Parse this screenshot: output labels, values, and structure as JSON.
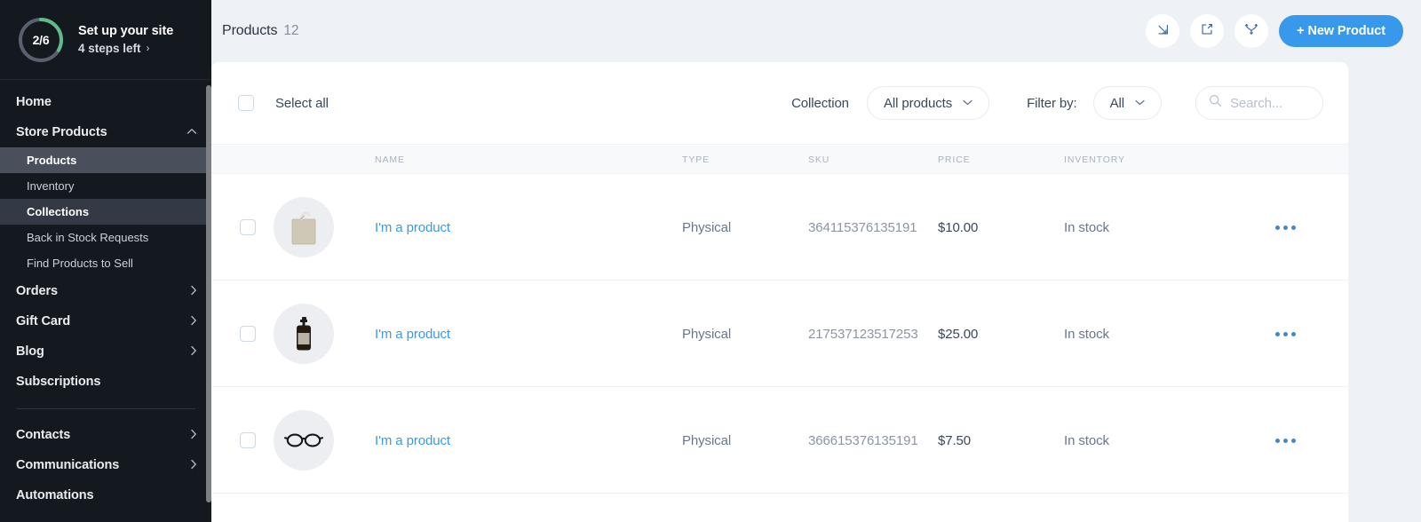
{
  "colors": {
    "accent": "#3899ec",
    "sidebar_bg": "#14181f",
    "progress_green": "#5bbd8a",
    "progress_track": "#5a6070",
    "page_bg": "#eef1f5"
  },
  "sidebar": {
    "setup": {
      "progress_text": "2/6",
      "progress_value": 2,
      "progress_total": 6,
      "title": "Set up your site",
      "subtitle": "4 steps left",
      "chevron": "›"
    },
    "items": [
      {
        "label": "Home",
        "type": "item",
        "caret": "",
        "state": ""
      },
      {
        "label": "Store Products",
        "type": "item",
        "caret": "⌃",
        "state": "expanded"
      },
      {
        "label": "Products",
        "type": "sub",
        "state": "active"
      },
      {
        "label": "Inventory",
        "type": "sub",
        "state": ""
      },
      {
        "label": "Collections",
        "type": "sub",
        "state": "hover"
      },
      {
        "label": "Back in Stock Requests",
        "type": "sub",
        "state": ""
      },
      {
        "label": "Find Products to Sell",
        "type": "sub",
        "state": ""
      },
      {
        "label": "Orders",
        "type": "item",
        "caret": "›",
        "state": ""
      },
      {
        "label": "Gift Card",
        "type": "item",
        "caret": "›",
        "state": ""
      },
      {
        "label": "Blog",
        "type": "item",
        "caret": "›",
        "state": ""
      },
      {
        "label": "Subscriptions",
        "type": "item",
        "caret": "",
        "state": ""
      },
      {
        "label": "Contacts",
        "type": "item",
        "caret": "›",
        "state": ""
      },
      {
        "label": "Communications",
        "type": "item",
        "caret": "›",
        "state": ""
      },
      {
        "label": "Automations",
        "type": "item",
        "caret": "",
        "state": ""
      }
    ]
  },
  "header": {
    "title": "Products",
    "count": "12",
    "actions": [
      {
        "icon": "import-icon",
        "label": "Import"
      },
      {
        "icon": "export-icon",
        "label": "Export"
      },
      {
        "icon": "sync-icon",
        "label": "Sync"
      }
    ],
    "new_product_label": "+ New Product"
  },
  "toolbar": {
    "select_all_label": "Select all",
    "collection_label": "Collection",
    "collection_value": "All products",
    "filter_label": "Filter by:",
    "filter_value": "All",
    "search_placeholder": "Search...",
    "search_value": "",
    "chevron": "⌄"
  },
  "table": {
    "columns": [
      "NAME",
      "TYPE",
      "SKU",
      "PRICE",
      "INVENTORY"
    ],
    "rows": [
      {
        "name": "I'm a product",
        "type": "Physical",
        "sku": "364115376135191",
        "price": "$10.00",
        "inventory": "In stock",
        "thumb": "tote-bag-thumbnail"
      },
      {
        "name": "I'm a product",
        "type": "Physical",
        "sku": "217537123517253",
        "price": "$25.00",
        "inventory": "In stock",
        "thumb": "pump-bottle-thumbnail"
      },
      {
        "name": "I'm a product",
        "type": "Physical",
        "sku": "366615376135191",
        "price": "$7.50",
        "inventory": "In stock",
        "thumb": "eyeglasses-thumbnail"
      }
    ]
  }
}
